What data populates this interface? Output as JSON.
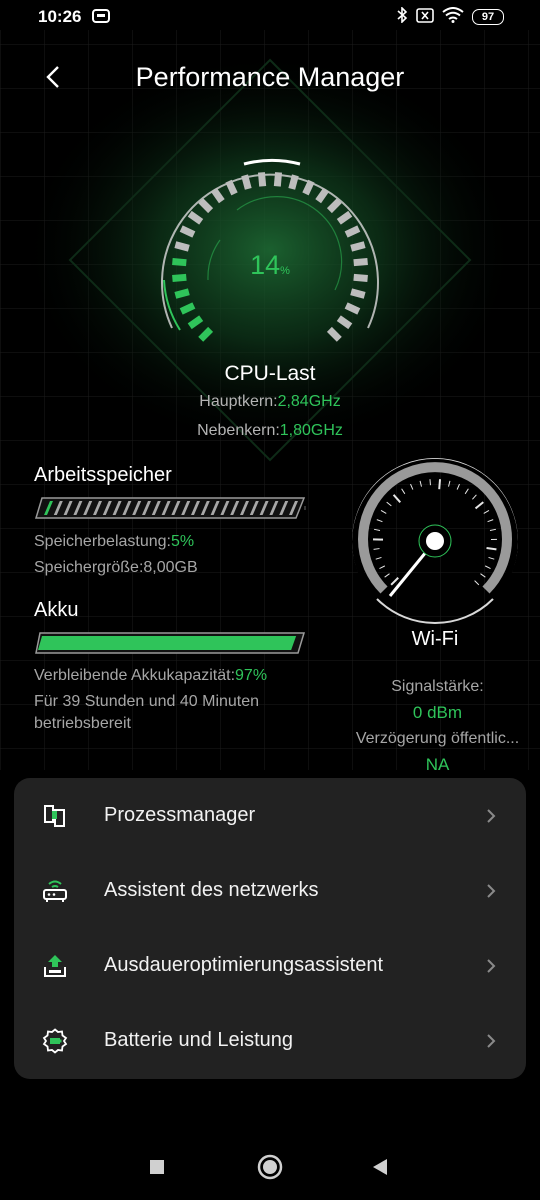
{
  "status_bar": {
    "time": "10:26",
    "battery_level": "97",
    "icons": [
      "screen-record-icon",
      "bluetooth-icon",
      "no-sim-icon",
      "wifi-icon",
      "battery-icon"
    ]
  },
  "header": {
    "title": "Performance Manager",
    "back_icon": "back-arrow-icon"
  },
  "cpu": {
    "load_value": "14",
    "load_unit": "%",
    "load_fraction": 0.14,
    "label": "CPU-Last",
    "main_core_label": "Hauptkern:",
    "main_core_value": "2,84GHz",
    "secondary_core_label": "Nebenkern:",
    "secondary_core_value": "1,80GHz"
  },
  "memory": {
    "title": "Arbeitsspeicher",
    "load_label": "Speicherbelastung:",
    "load_value": "5%",
    "load_fraction": 0.05,
    "size_label": "Speichergröße:",
    "size_value": "8,00GB"
  },
  "battery": {
    "title": "Akku",
    "capacity_label": "Verbleibende Akkukapazität:",
    "capacity_value": "97%",
    "capacity_fraction": 0.97,
    "runtime_line1": "Für 39 Stunden und 40 Minuten",
    "runtime_line2": "betriebsbereit"
  },
  "wifi": {
    "label": "Wi-Fi",
    "signal_label": "Signalstärke:",
    "signal_value": "0 dBm",
    "delay_label": "Verzögerung öffentlic...",
    "delay_value": "NA"
  },
  "menu": {
    "items": [
      {
        "label": "Prozessmanager",
        "icon": "process-manager-icon"
      },
      {
        "label": "Assistent des netzwerks",
        "icon": "network-router-icon"
      },
      {
        "label": "Ausdaueroptimierungsassistent",
        "icon": "endurance-upload-icon"
      },
      {
        "label": "Batterie und Leistung",
        "icon": "battery-gear-icon"
      }
    ]
  },
  "colors": {
    "accent": "#2fc45a",
    "background": "#000000",
    "card": "#222222",
    "muted_text": "#a6a6a6"
  }
}
